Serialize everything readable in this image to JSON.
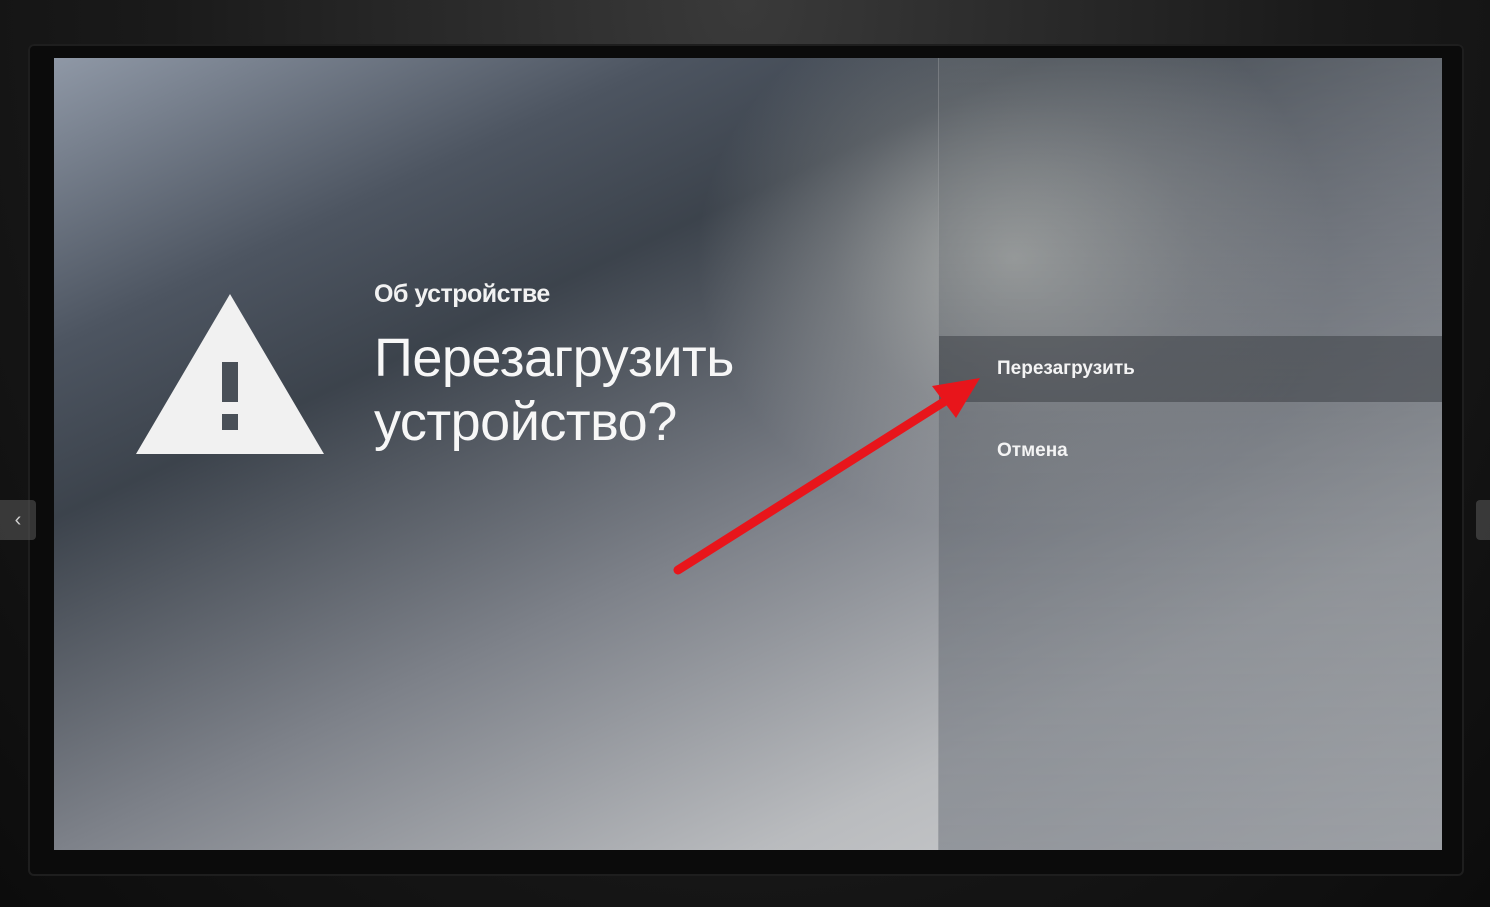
{
  "dialog": {
    "section_label": "Об устройстве",
    "title": "Перезагрузить устройство?",
    "icon": "warning-triangle-icon"
  },
  "menu": {
    "items": [
      {
        "label": "Перезагрузить",
        "selected": true
      },
      {
        "label": "Отмена",
        "selected": false
      }
    ]
  },
  "viewer": {
    "prev_icon": "‹"
  },
  "colors": {
    "annotation_arrow": "#e8151b"
  }
}
